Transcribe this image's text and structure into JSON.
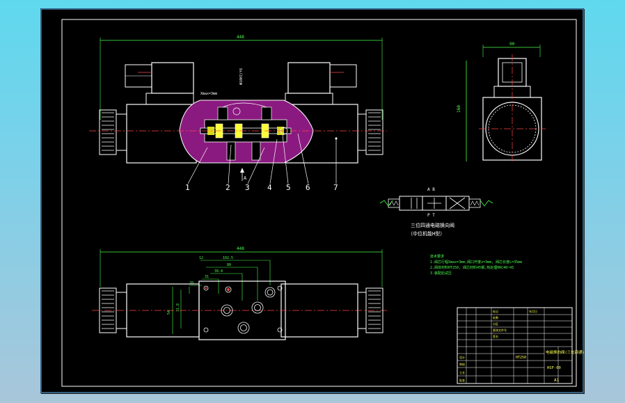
{
  "dims": {
    "overall_width_top": "448",
    "overall_width_bottom": "448",
    "side_width": "90",
    "side_height": "160",
    "stroke_label": "Xmax=3mm",
    "bore_label": "Φ10H7/f6",
    "base_dims": [
      "12",
      "102.5",
      "80",
      "39.4",
      "31",
      "20",
      "54",
      "31.8"
    ]
  },
  "leaders": [
    "1",
    "2",
    "3",
    "4",
    "5",
    "6",
    "7"
  ],
  "view_arrow": "A",
  "symbol": {
    "ports_top": "A  B",
    "ports_bottom": "P  T",
    "caption_line1": "三位四通电磁换向阀",
    "caption_line2": "（中位机能H型）"
  },
  "tech_notes": {
    "title": "技术要求",
    "lines": [
      "1.阀芯行程Xmax=3mm,阀口开度x=3mm, 阀芯长度L=35mm",
      "2.阀体材料HT250, 阀芯材料45钢,热处理HRC40~45",
      "3.装配后试压"
    ]
  },
  "title_block": {
    "drawing_name": "电磁换向阀(三位四通)",
    "drawing_no": "HSF-00",
    "sheet_size": "A1",
    "material": "HT250",
    "header_cells": [
      "标记",
      "处数",
      "分区",
      "更改文件号",
      "签名",
      "年月日"
    ],
    "role_cells": [
      "设计",
      "审核",
      "工艺",
      "批准"
    ]
  }
}
